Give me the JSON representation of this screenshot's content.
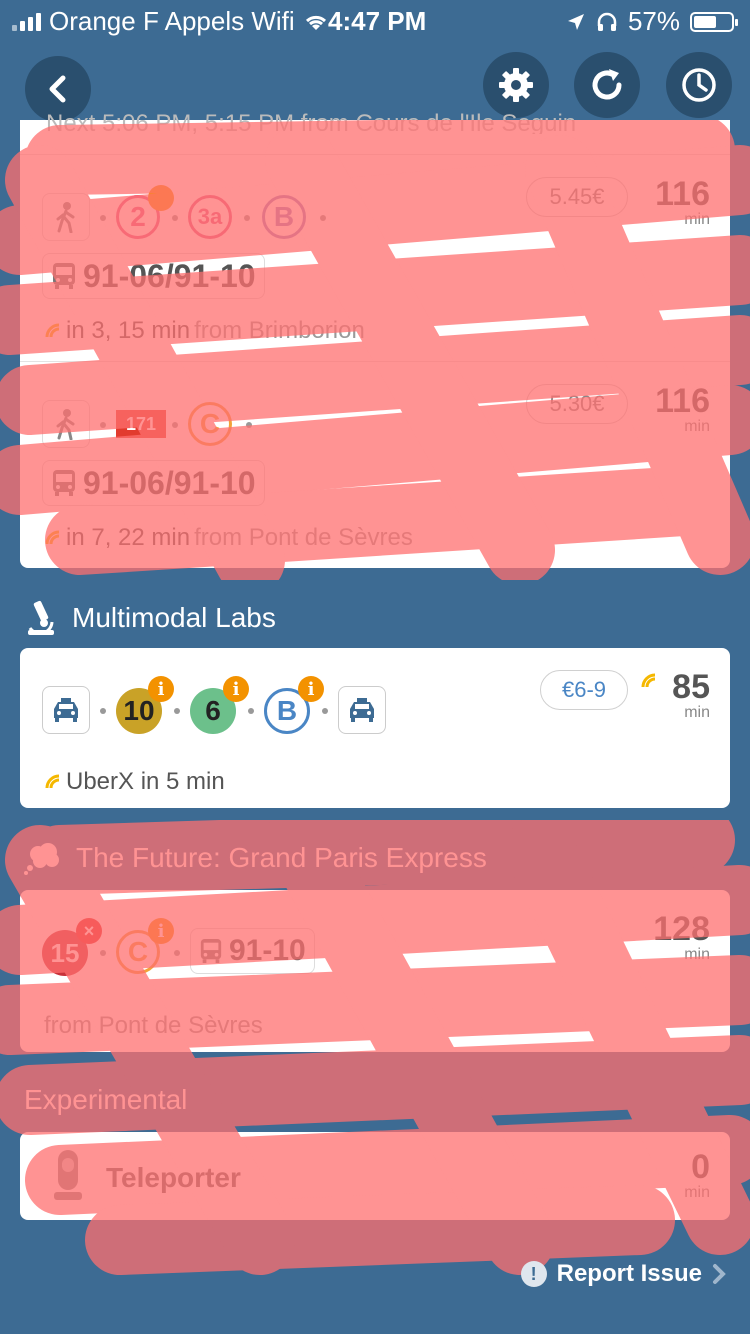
{
  "status_bar": {
    "carrier": "Orange F Appels Wifi",
    "time": "4:47 PM",
    "battery": "57%"
  },
  "header": {
    "partial_text": "Next 5:06 PM, 5:15 PM from Cours de l'Ile Seguin"
  },
  "routes_top": [
    {
      "badges": [
        "2",
        "3a",
        "B"
      ],
      "price": "5.45€",
      "minutes": "116",
      "unit": "min",
      "bus_label": "91-06/91-10",
      "rt_text": "in 3, 15 min",
      "rt_from": "from Brimborion"
    },
    {
      "badges": [
        "171",
        "C"
      ],
      "price": "5.30€",
      "minutes": "116",
      "unit": "min",
      "bus_label": "91-06/91-10",
      "rt_text": "in 7, 22 min",
      "rt_from": "from Pont de Sèvres"
    }
  ],
  "multimodal": {
    "section_title": "Multimodal Labs",
    "badges": [
      "10",
      "6",
      "B"
    ],
    "price": "€6-9",
    "minutes": "85",
    "unit": "min",
    "rt_text": "UberX in 5 min"
  },
  "future": {
    "section_title": "The Future: Grand Paris Express",
    "badges": [
      "15",
      "C"
    ],
    "bus_label": "91-10",
    "minutes": "128",
    "unit": "min",
    "from_text": "from Pont de Sèvres"
  },
  "experimental": {
    "section_title": "Experimental",
    "label": "Teleporter",
    "minutes": "0",
    "unit": "min"
  },
  "footer": {
    "report_label": "Report Issue"
  },
  "colors": {
    "background": "#3d6b93",
    "line10": "#c9a227",
    "line6": "#6cc08b",
    "lineB": "#4a86c5",
    "info": "#f39200",
    "scribble": "#ff6f6f"
  }
}
